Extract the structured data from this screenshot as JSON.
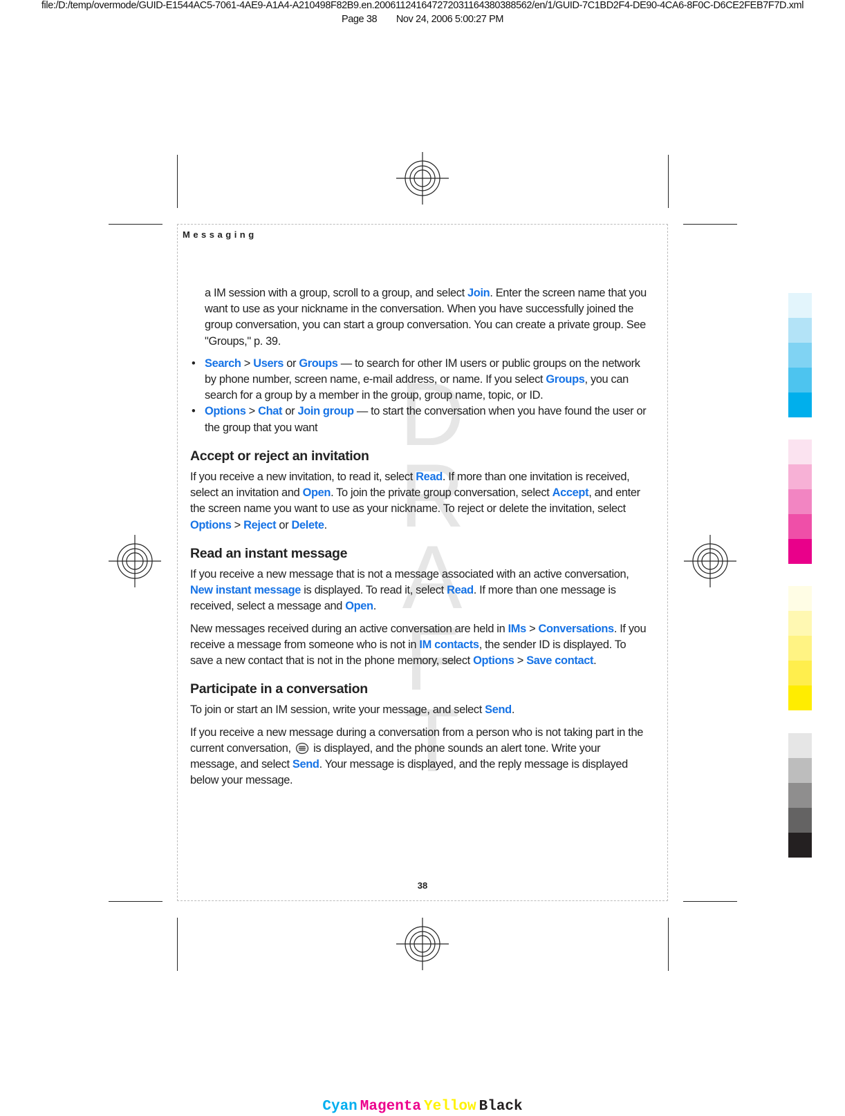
{
  "print_header": {
    "file_path": "file:/D:/temp/overmode/GUID-E1544AC5-7061-4AE9-A1A4-A210498F82B9.en.20061124164727203116438038856​2/en/1/GUID-7C1BD2F4-DE90-4CA6-8F0C-D6CE2FEB7F7D.xml",
    "page_label": "Page 38",
    "timestamp": "Nov 24, 2006 5:00:27 PM"
  },
  "section_label": "Messaging",
  "watermark": [
    "D",
    "R",
    "A",
    "F",
    "T"
  ],
  "intro": {
    "t1": "a IM session with a group, scroll to a group, and select ",
    "k1": "Join",
    "t2": ". Enter the screen name that you want to use as your nickname in the conversation. When you have successfully joined the group conversation, you can start a group conversation. You can create a private group. See \"Groups,\" p. 39."
  },
  "bullets": [
    {
      "k1": "Search",
      "s1": " > ",
      "k2": "Users",
      "s2": " or ",
      "k3": "Groups",
      "t1": "  — to search for other IM users or public groups on the network by phone number, screen name, e-mail address, or name. If you select ",
      "k4": "Groups",
      "t2": ", you can search for a group by a member in the group, group name, topic, or ID."
    },
    {
      "k1": "Options",
      "s1": " > ",
      "k2": "Chat",
      "s2": " or ",
      "k3": "Join group",
      "t1": " — to start the conversation when you have found the user or the group that you want"
    }
  ],
  "sections": {
    "accept": {
      "heading": "Accept or reject an invitation",
      "t1": "If you receive a new invitation, to read it, select ",
      "k1": "Read",
      "t2": ". If more than one invitation is received, select an invitation and ",
      "k2": "Open",
      "t3": ". To join the private group conversation, select ",
      "k3": "Accept",
      "t4": ", and enter the screen name you want to use as your nickname. To reject or delete the invitation, select ",
      "k4": "Options",
      "s1": " > ",
      "k5": "Reject",
      "s2": " or ",
      "k6": "Delete",
      "t5": "."
    },
    "read": {
      "heading": "Read an instant message",
      "p1": {
        "t1": "If you receive a new message that is not a message associated with an active conversation, ",
        "k1": "New instant message",
        "t2": " is displayed. To read it, select ",
        "k2": "Read",
        "t3": ". If more than one message is received, select a message and ",
        "k3": "Open",
        "t4": "."
      },
      "p2": {
        "t1": "New messages received during an active conversation are held in ",
        "k1": "IMs",
        "s1": " > ",
        "k2": "Conversations",
        "t2": ". If you receive a message from someone who is not in ",
        "k3": "IM contacts",
        "t3": ", the sender ID is displayed. To save a new contact that is not in the phone memory, select ",
        "k4": "Options",
        "s2": " > ",
        "k5": "Save contact",
        "t4": "."
      }
    },
    "participate": {
      "heading": "Participate in a conversation",
      "p1": {
        "t1": "To join or start an IM session, write your message, and select ",
        "k1": "Send",
        "t2": "."
      },
      "p2": {
        "t1": "If you receive a new message during a conversation from a person who is not taking part in the current conversation, ",
        "icon": "new-message-icon",
        "t2": " is displayed, and the phone sounds an alert tone. Write your message, and select ",
        "k1": "Send",
        "t3": ". Your message is displayed, and the reply message is displayed below your message."
      }
    }
  },
  "page_number": "38",
  "color_bars": {
    "cyan": [
      "#e3f5fc",
      "#b3e3f7",
      "#80d3f3",
      "#4dc4ef",
      "#00afec"
    ],
    "magenta": [
      "#fbe3f0",
      "#f7b1d6",
      "#f285c2",
      "#ef4fa8",
      "#e9008a"
    ],
    "yellow": [
      "#fffde5",
      "#fff8b2",
      "#fff383",
      "#ffee4d",
      "#ffed00"
    ],
    "black": [
      "#e6e6e6",
      "#bdbdbd",
      "#8f8e8e",
      "#646363",
      "#242021"
    ]
  },
  "cmyk_labels": [
    {
      "text": "Cyan",
      "color": "#00aeef"
    },
    {
      "text": "Magenta",
      "color": "#ec008c"
    },
    {
      "text": "Yellow",
      "color": "#fff200"
    },
    {
      "text": "Black",
      "color": "#231f20"
    }
  ],
  "link_color": "#1673e6"
}
